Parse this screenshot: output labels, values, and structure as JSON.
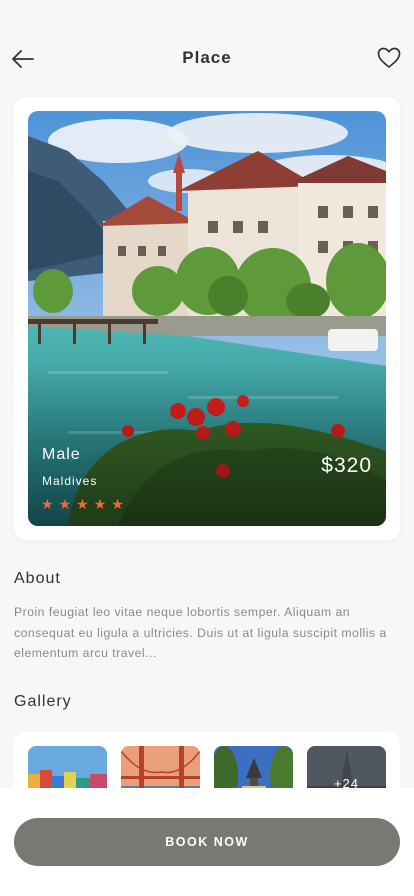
{
  "header": {
    "title": "Place",
    "back_icon": "arrow-left-icon",
    "favorite_icon": "heart-outline-icon"
  },
  "place": {
    "name": "Male",
    "region": "Maldives",
    "price": "$320",
    "rating": 5,
    "rating_max": 5
  },
  "about": {
    "title": "About",
    "text": "Proin feugiat leo vitae neque lobortis semper. Aliquam an consequat eu ligula a ultricies. Duis ut at ligula suscipit mollis a elementum arcu travel..."
  },
  "gallery": {
    "title": "Gallery",
    "more_label": "+24"
  },
  "actions": {
    "book_label": "BOOK NOW"
  },
  "colors": {
    "accent_star": "#f06a3c",
    "button": "#7a7873",
    "background": "#f7f7f8"
  }
}
